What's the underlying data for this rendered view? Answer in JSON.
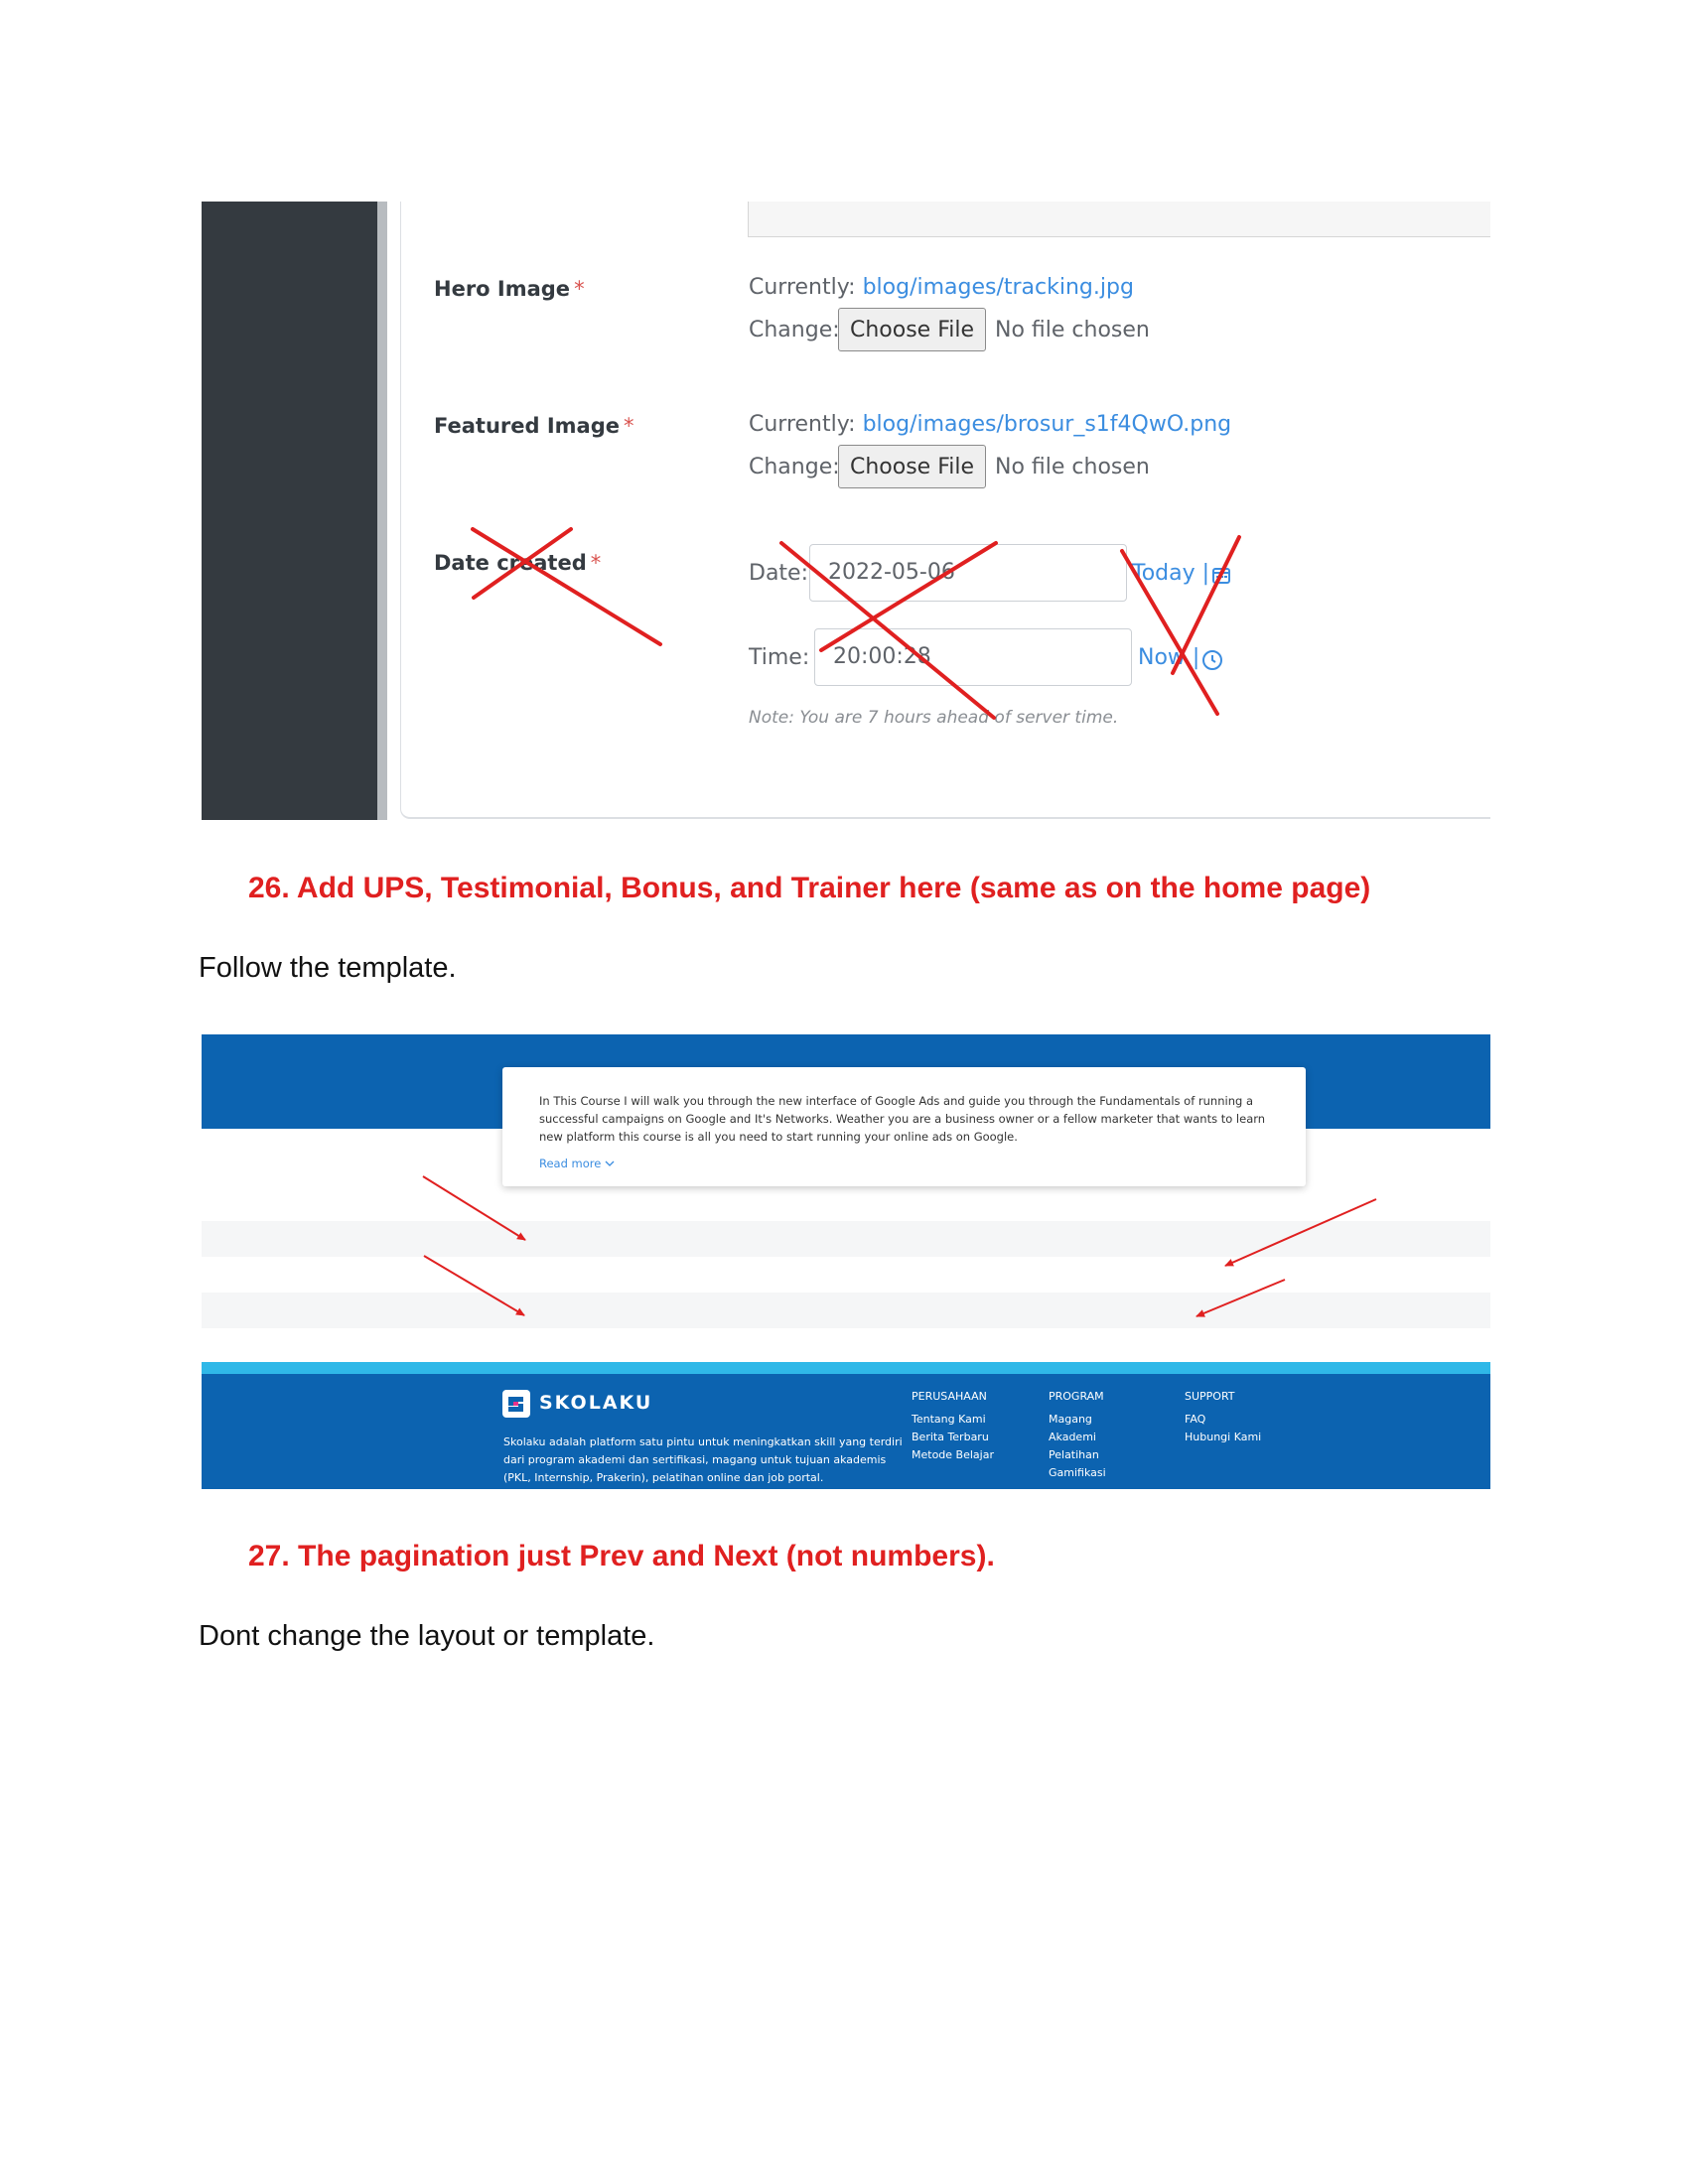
{
  "admin_form": {
    "hero_image": {
      "label": "Hero Image",
      "required_mark": "*",
      "currently_label": "Currently:",
      "current_file": "blog/images/tracking.jpg",
      "change_label": "Change:",
      "choose_button": "Choose File",
      "no_file_text": "No file chosen"
    },
    "featured_image": {
      "label": "Featured Image",
      "required_mark": "*",
      "currently_label": "Currently:",
      "current_file": "blog/images/brosur_s1f4QwO.png",
      "change_label": "Change:",
      "choose_button": "Choose File",
      "no_file_text": "No file chosen"
    },
    "date_created": {
      "label": "Date created",
      "required_mark": "*",
      "date_label": "Date:",
      "date_value": "2022-05-06",
      "today_link": "Today",
      "separator": "|",
      "time_label": "Time:",
      "time_value": "20:00:28",
      "now_link": "Now",
      "note": "Note: You are 7 hours ahead of server time."
    },
    "annotation_color": "#e02020"
  },
  "instructions": {
    "item26_heading": "26. Add UPS, Testimonial, Bonus, and Trainer here (same as on the home page)",
    "item26_text": "Follow the template.",
    "item27_heading": "27. The pagination just Prev and Next (not numbers).",
    "item27_text": "Dont change the layout or template."
  },
  "template_preview": {
    "course_description": "In This Course I will walk you through the new interface of Google Ads and guide you through the Fundamentals of running a successful campaigns on Google and It's Networks. Weather you are a business owner or a fellow marketer that wants to learn new platform this course is all you need to start running your online ads on Google.",
    "read_more": "Read more",
    "brand_color": "#0c63b0",
    "footer": {
      "brand": "SKOLAKU",
      "description": "Skolaku adalah platform satu pintu untuk meningkatkan skill yang terdiri dari program akademi dan sertifikasi, magang untuk tujuan akademis (PKL, Internship, Prakerin), pelatihan online dan job portal.",
      "columns": [
        {
          "heading": "PERUSAHAAN",
          "items": [
            "Tentang Kami",
            "Berita Terbaru",
            "Metode Belajar"
          ]
        },
        {
          "heading": "PROGRAM",
          "items": [
            "Magang",
            "Akademi",
            "Pelatihan",
            "Gamifikasi"
          ]
        },
        {
          "heading": "SUPPORT",
          "items": [
            "FAQ",
            "Hubungi Kami"
          ]
        }
      ]
    }
  }
}
